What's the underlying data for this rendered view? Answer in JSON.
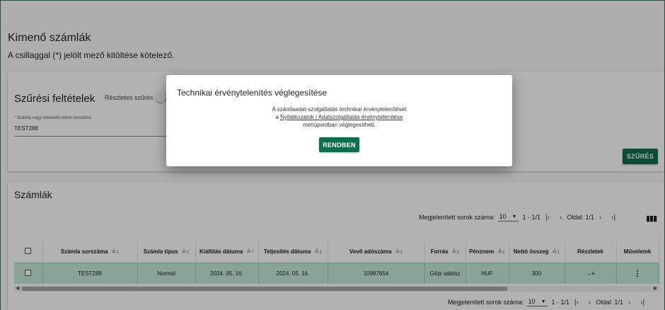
{
  "page": {
    "title": "Kimenő számlák",
    "subtitle": "A csillaggal (*) jelölt mező kitöltése kötelező."
  },
  "filter": {
    "title": "Szűrési feltételek",
    "detailed_filter_label": "Részletes szűrés",
    "field_label": "* Számla vagy módosító okirat sorszáma",
    "field_value": "TEST288",
    "search_button": "SZŰRÉS"
  },
  "invoices": {
    "title": "Számlák",
    "pager": {
      "rows_label": "Megjelenített sorok száma:",
      "rows_value": "10",
      "range": "1 - 1/1",
      "page_label": "Oldal: 1/1"
    },
    "columns": [
      "Számla sorszáma",
      "Számla típus",
      "Kiállítás dátuma",
      "Teljesítés dátuma",
      "Vevő adószáma",
      "Forrás",
      "Pénznem",
      "Nettó összeg",
      "Részletek",
      "Műveletek"
    ],
    "rows": [
      {
        "invoice_number": "TEST288",
        "type": "Normál",
        "issue_date": "2024. 05. 16.",
        "fulfillment_date": "2024. 05. 16.",
        "buyer_tax_number": "10987654",
        "source": "Gépi adatsz",
        "currency": "HUF",
        "net_amount": "300",
        "details_icon": "arrow-into-list-icon",
        "actions_icon": "more-vert-icon"
      }
    ]
  },
  "modal": {
    "title": "Technikai érvénytelenítés véglegesítése",
    "line1": "A számlaadat-szolgáltatás technikai érvénytelenítését",
    "line2_prefix": "a ",
    "line2_link": "Nyilatkozatok / Adatszolgáltatás érvénytelenítése",
    "line3": "menüpontban véglegesítheti.",
    "ok_button": "RENDBEN"
  },
  "colors": {
    "primary": "#0f6d4f",
    "selected_row": "#c4ead7",
    "overlay": "rgba(0,0,0,0.3)"
  }
}
